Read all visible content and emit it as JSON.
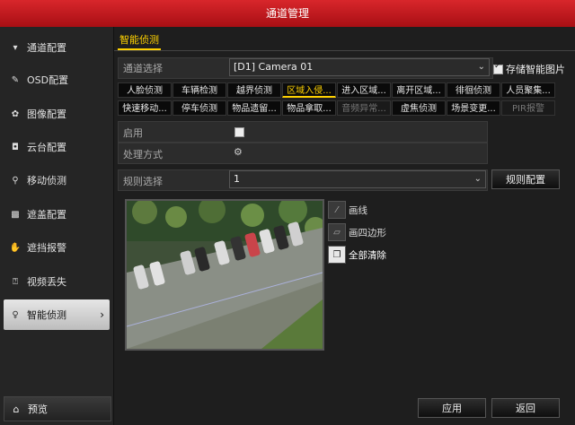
{
  "title": "通道管理",
  "sidebar": {
    "items": [
      {
        "label": "通道配置",
        "icon": "channel-icon"
      },
      {
        "label": "OSD配置",
        "icon": "osd-icon"
      },
      {
        "label": "图像配置",
        "icon": "image-icon"
      },
      {
        "label": "云台配置",
        "icon": "ptz-icon"
      },
      {
        "label": "移动侦测",
        "icon": "motion-icon"
      },
      {
        "label": "遮盖配置",
        "icon": "mask-icon"
      },
      {
        "label": "遮挡报警",
        "icon": "tamper-icon"
      },
      {
        "label": "视频丢失",
        "icon": "video-loss-icon"
      },
      {
        "label": "智能侦测",
        "icon": "smart-icon"
      }
    ],
    "preview": "预览"
  },
  "tab": "智能侦测",
  "channel": {
    "label": "通道选择",
    "value": "[D1] Camera 01",
    "save_label": "存储智能图片",
    "save_checked": true
  },
  "detections": {
    "row1": [
      "人脸侦测",
      "车辆检测",
      "越界侦测",
      "区域入侵...",
      "进入区域...",
      "离开区域...",
      "徘徊侦测",
      "人员聚集..."
    ],
    "row2": [
      "快速移动...",
      "停车侦测",
      "物品遗留...",
      "物品拿取...",
      "音频异常...",
      "虚焦侦测",
      "场景变更...",
      "PIR报警"
    ],
    "selected": "区域入侵..."
  },
  "enable_label": "启用",
  "process_label": "处理方式",
  "rule": {
    "label": "规则选择",
    "value": "1",
    "config_btn": "规则配置"
  },
  "tools": {
    "draw_line": "画线",
    "draw_quad": "画四边形",
    "clear_all": "全部清除"
  },
  "buttons": {
    "apply": "应用",
    "back": "返回"
  }
}
